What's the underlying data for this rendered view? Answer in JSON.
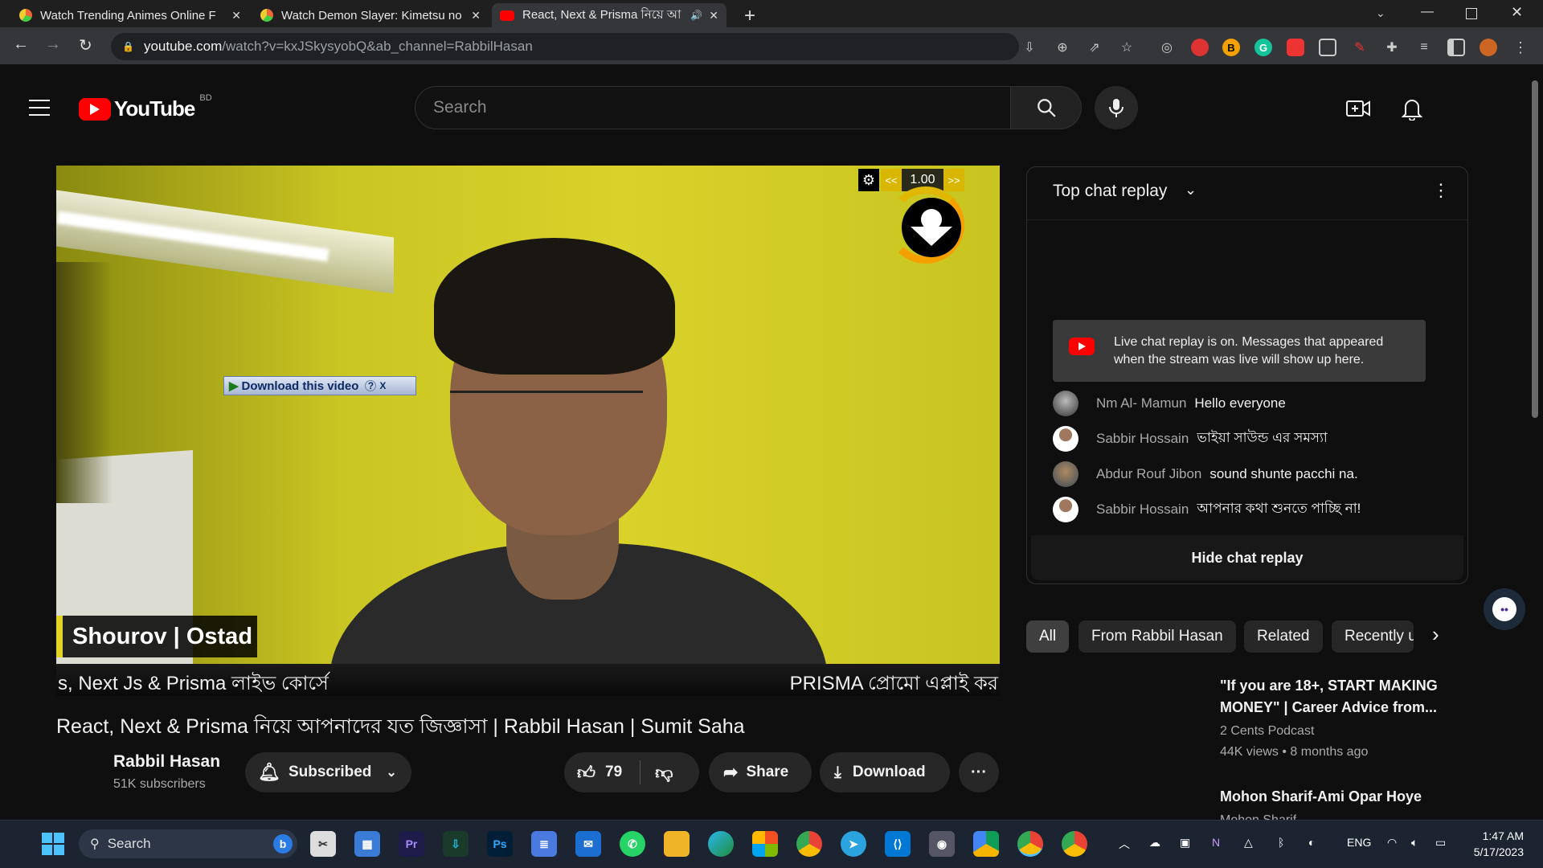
{
  "browser": {
    "tabs": [
      {
        "title": "Watch Trending Animes Online F",
        "active": false
      },
      {
        "title": "Watch Demon Slayer: Kimetsu no",
        "active": false
      },
      {
        "title": "React, Next & Prisma নিয়ে আ",
        "active": true
      }
    ],
    "new_tab": "+",
    "url_host": "youtube.com",
    "url_path": "/watch?v=kxJSkysyobQ&ab_channel=RabbilHasan"
  },
  "youtube": {
    "logo_text": "YouTube",
    "region": "BD",
    "search_placeholder": "Search"
  },
  "video": {
    "speed_value": "1.00",
    "speed_prev": "<<",
    "speed_next": ">>",
    "download_overlay": "Download this video",
    "download_overlay_help": "?",
    "download_overlay_close": "X",
    "name_card": "Shourov | Ostad",
    "ticker_left": "s, Next Js & Prisma লাইভ কোর্সে",
    "ticker_right": "PRISMA প্রোমো এপ্লাই কর",
    "title": "React, Next & Prisma নিয়ে আপনাদের যত জিজ্ঞাসা | Rabbil Hasan | Sumit Saha"
  },
  "channel": {
    "name": "Rabbil Hasan",
    "subscribers": "51K subscribers",
    "subscribed_label": "Subscribed",
    "likes": "79",
    "share_label": "Share",
    "download_label": "Download",
    "more_label": "···"
  },
  "chat": {
    "header": "Top chat replay",
    "notice": "Live chat replay is on. Messages that appeared when the stream was live will show up here.",
    "messages": [
      {
        "author": "Nm Al- Mamun",
        "text": "Hello everyone"
      },
      {
        "author": "Sabbir Hossain",
        "text": "ভাইয়া সাউন্ড এর সমস্যা"
      },
      {
        "author": "Abdur Rouf Jibon",
        "text": "sound shunte pacchi na."
      },
      {
        "author": "Sabbir Hossain",
        "text": "আপনার কথা শুনতে পাচ্ছি না!"
      }
    ],
    "hide_label": "Hide chat replay"
  },
  "chips": [
    "All",
    "From Rabbil Hasan",
    "Related",
    "Recently u"
  ],
  "suggestions": [
    {
      "title_line1": "\"If you are 18+, START MAKING",
      "title_line2": "MONEY\" | Career Advice from...",
      "channel": "2 Cents Podcast",
      "meta": "44K views • 8 months ago"
    },
    {
      "title_line1": "Mohon Sharif-Ami Opar Hoye",
      "title_line2": "",
      "channel": "Mohon Sharif",
      "meta": ""
    }
  ],
  "taskbar": {
    "search_label": "Search",
    "lang": "ENG",
    "time": "1:47 AM",
    "date": "5/17/2023"
  },
  "colors": {
    "yt_red": "#ff0000",
    "page_bg": "#0f0f0f",
    "accent_yellow": "#e2d31f",
    "taskbar_bg": "#1c2331"
  }
}
